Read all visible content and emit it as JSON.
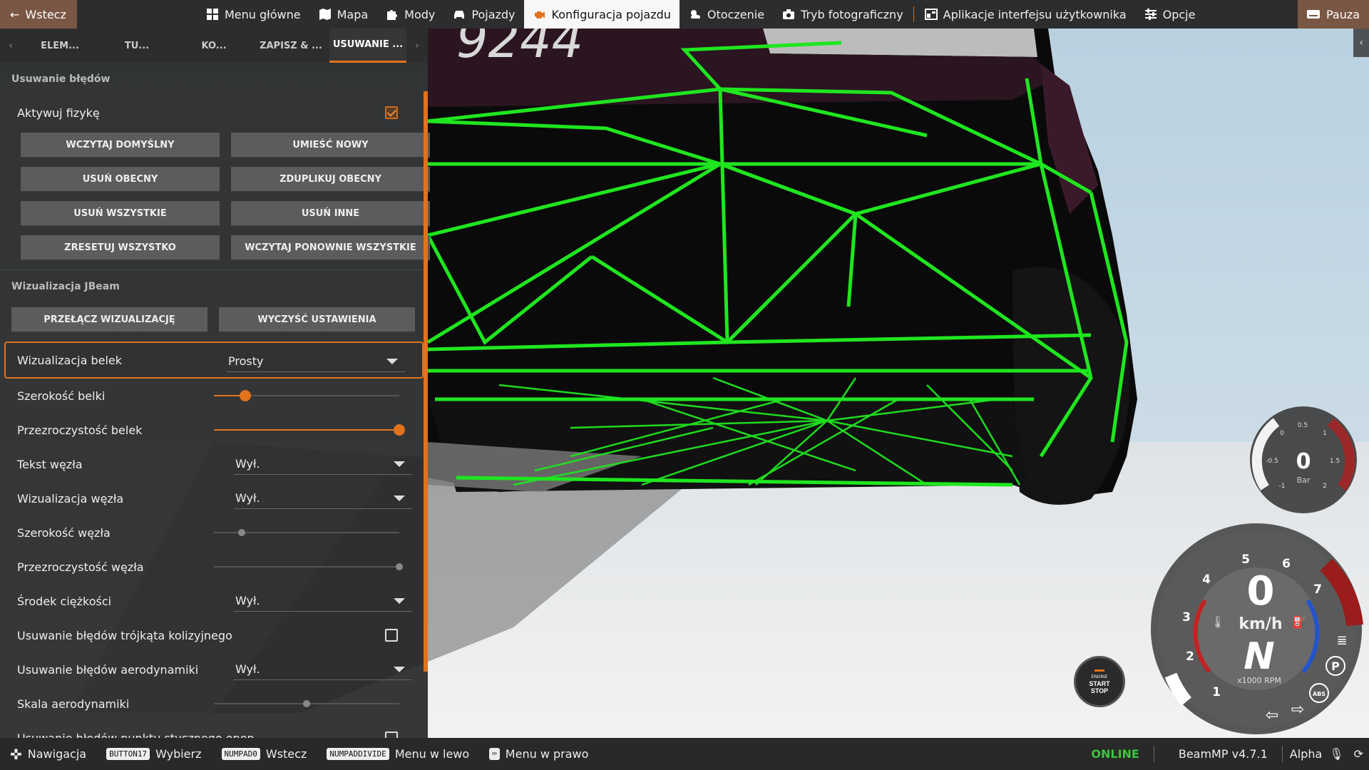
{
  "topbar": {
    "back_label": "Wstecz",
    "items": [
      {
        "label": "Menu główne",
        "icon": "grid-icon"
      },
      {
        "label": "Mapa",
        "icon": "map-icon"
      },
      {
        "label": "Mody",
        "icon": "puzzle-icon"
      },
      {
        "label": "Pojazdy",
        "icon": "car-icon"
      },
      {
        "label": "Konfiguracja pojazdu",
        "icon": "engine-icon",
        "active": true
      },
      {
        "label": "Otoczenie",
        "icon": "weather-icon"
      },
      {
        "label": "Tryb fotograficzny",
        "icon": "camera-icon"
      },
      {
        "label": "Aplikacje interfejsu użytkownika",
        "icon": "apps-icon"
      },
      {
        "label": "Opcje",
        "icon": "sliders-icon"
      }
    ],
    "pause_label": "Pauza"
  },
  "tabs": [
    "ELEM...",
    "TU...",
    "KO...",
    "ZAPISZ & ...",
    "USUWANIE ..."
  ],
  "debug_section": {
    "title": "Usuwanie błędów",
    "physics_label": "Aktywuj fizykę",
    "physics_checked": true,
    "buttons": [
      "WCZYTAJ DOMYŚLNY",
      "UMIEŚĆ NOWY",
      "USUŃ OBECNY",
      "ZDUPLIKUJ OBECNY",
      "USUŃ WSZYSTKIE",
      "USUŃ INNE",
      "ZRESETUJ WSZYSTKO",
      "WCZYTAJ PONOWNIE WSZYSTKIE"
    ]
  },
  "jbeam_section": {
    "title": "Wizualizacja JBeam",
    "toggle_label": "PRZEŁĄCZ WIZUALIZACJĘ",
    "clear_label": "WYCZYŚĆ USTAWIENIA",
    "rows": {
      "beam_vis_label": "Wizualizacja belek",
      "beam_vis_value": "Prosty",
      "beam_width_label": "Szerokość belki",
      "beam_width_level": 0.17,
      "beam_alpha_label": "Przezroczystość belek",
      "beam_alpha_level": 1.0,
      "node_text_label": "Tekst węzła",
      "node_text_value": "Wył.",
      "node_vis_label": "Wizualizacja węzła",
      "node_vis_value": "Wył.",
      "node_width_label": "Szerokość węzła",
      "node_width_level": 0.15,
      "node_alpha_label": "Przezroczystość węzła",
      "node_alpha_level": 1.0,
      "cog_label": "Środek ciężkości",
      "cog_value": "Wył.",
      "collision_tri_label": "Usuwanie błędów trójkąta kolizyjnego",
      "collision_tri_checked": false,
      "aero_label": "Usuwanie błędów aerodynamiki",
      "aero_value": "Wył.",
      "aero_scale_label": "Skala aerodynamiki",
      "aero_scale_level": 0.5,
      "tire_contact_label": "Usuwanie błędów punktu stycznego opon",
      "tire_contact_checked": false
    }
  },
  "bottombar": {
    "nav_label": "Nawigacja",
    "select_key": "BUTTON17",
    "select_label": "Wybierz",
    "back_key": "NUMPAD0",
    "back_label": "Wstecz",
    "left_key": "NUMPADDIVIDE",
    "left_label": "Menu w lewo",
    "right_label": "Menu w prawo",
    "status": "ONLINE",
    "version": "BeamMP v4.7.1",
    "alpha": "Alpha"
  },
  "hud": {
    "boost_value": "0",
    "boost_unit": "Bar",
    "boost_ticks": [
      "0.5",
      "0",
      "1",
      "-0.5",
      "1.5",
      "-1",
      "2"
    ],
    "speed": "0",
    "speed_unit": "km/h",
    "gear": "N",
    "rpm_unit": "x1000 RPM",
    "rpm_ticks": [
      "1",
      "2",
      "3",
      "4",
      "5",
      "6",
      "7"
    ],
    "engine_l1": "ENGINE",
    "engine_l2": "START",
    "engine_l3": "STOP",
    "abs": "ABS",
    "park": "P",
    "plate_fragment": "9244"
  },
  "colors": {
    "accent": "#e1721e",
    "beam_green": "#1fe61f",
    "online": "#3ec43e"
  }
}
